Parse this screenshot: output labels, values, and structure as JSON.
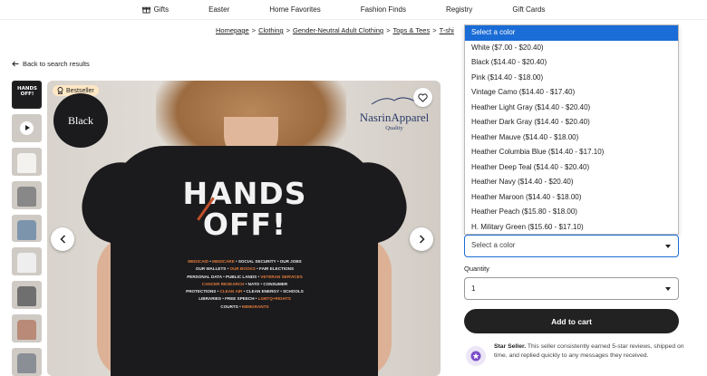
{
  "topnav": {
    "items": [
      "Gifts",
      "Easter",
      "Home Favorites",
      "Fashion Finds",
      "Registry",
      "Gift Cards"
    ]
  },
  "breadcrumb": [
    "Homepage",
    "Clothing",
    "Gender-Neutral Adult Clothing",
    "Tops & Tees",
    "T-shi"
  ],
  "back_link": "Back to search results",
  "image": {
    "badge": "Bestseller",
    "swatch_label": "Black",
    "brand_name": "NasrinApparel",
    "brand_sub": "Quality",
    "print_title_line1": "HANDS",
    "print_title_line2": "OFF!",
    "print_lines": [
      [
        "MEDICAID",
        " • ",
        "MEDICARE",
        " • SOCIAL SECURITY • OUR JOBS"
      ],
      [
        "OUR WALLETS • ",
        "OUR BOOKS",
        " • FAIR ELECTIONS"
      ],
      [
        "PERSONAL DATA • PUBLIC LANDS • ",
        "VETERAN SERVICES"
      ],
      [
        "CANCER RESEARCH",
        " • NATO • CONSUMER"
      ],
      [
        "PROTECTIONS • ",
        "CLEAN AIR",
        " • CLEAN ENERGY • SCHOOLS"
      ],
      [
        "LIBRARIES • FREE SPEECH • ",
        "LGBTQ+RIGHTS"
      ],
      [
        "COURTS • ",
        "IMMIGRANTS",
        ""
      ]
    ]
  },
  "color_options": [
    "Select a color",
    "White ($7.00 - $20.40)",
    "Black ($14.40 - $20.40)",
    "Pink ($14.40 - $18.00)",
    "Vintage Camo ($14.40 - $17.40)",
    "Heather Light Gray ($14.40 - $20.40)",
    "Heather Dark Gray ($14.40 - $20.40)",
    "Heather Mauve ($14.40 - $18.00)",
    "Heather Columbia Blue ($14.40 - $17.10)",
    "Heather Deep Teal ($14.40 - $20.40)",
    "Heather Navy ($14.40 - $20.40)",
    "Heather Maroon ($14.40 - $18.00)",
    "Heather Peach ($15.80 - $18.00)",
    "H. Military Green ($15.60 - $17.10)"
  ],
  "color_select_value": "Select a color",
  "quantity_label": "Quantity",
  "quantity_value": "1",
  "add_to_cart": "Add to cart",
  "star_seller": {
    "title": "Star Seller.",
    "text": " This seller consistently earned 5-star reviews, shipped on time, and replied quickly to any messages they received."
  },
  "colors": {
    "accent": "#1a6cd6",
    "cart_button": "#222222",
    "bestseller_bg": "#fde7c4"
  }
}
